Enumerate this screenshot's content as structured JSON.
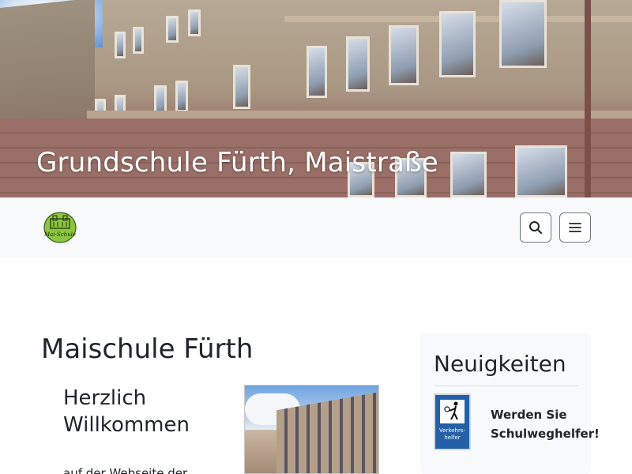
{
  "header": {
    "site_title": "Grundschule Fürth, Maistraße"
  },
  "navbar": {
    "logo_icon": "school-logo",
    "logo_text": "Mai-Schule",
    "search_icon": "search-icon",
    "menu_icon": "hamburger-menu-icon"
  },
  "main": {
    "page_title": "Maischule Fürth",
    "welcome_heading": "Herzlich Willkommen",
    "welcome_text": "auf der Webseite der"
  },
  "sidebar": {
    "title": "Neuigkeiten",
    "news": [
      {
        "thumb_label": "Verkehrs-\nhelfer",
        "title": "Werden Sie Schulweghelfer!"
      }
    ]
  },
  "colors": {
    "navbar_bg": "#f8f9fa",
    "text": "#212529",
    "button_border": "#6c757d",
    "sign_blue": "#2360a8",
    "logo_green": "#8cc63f"
  }
}
